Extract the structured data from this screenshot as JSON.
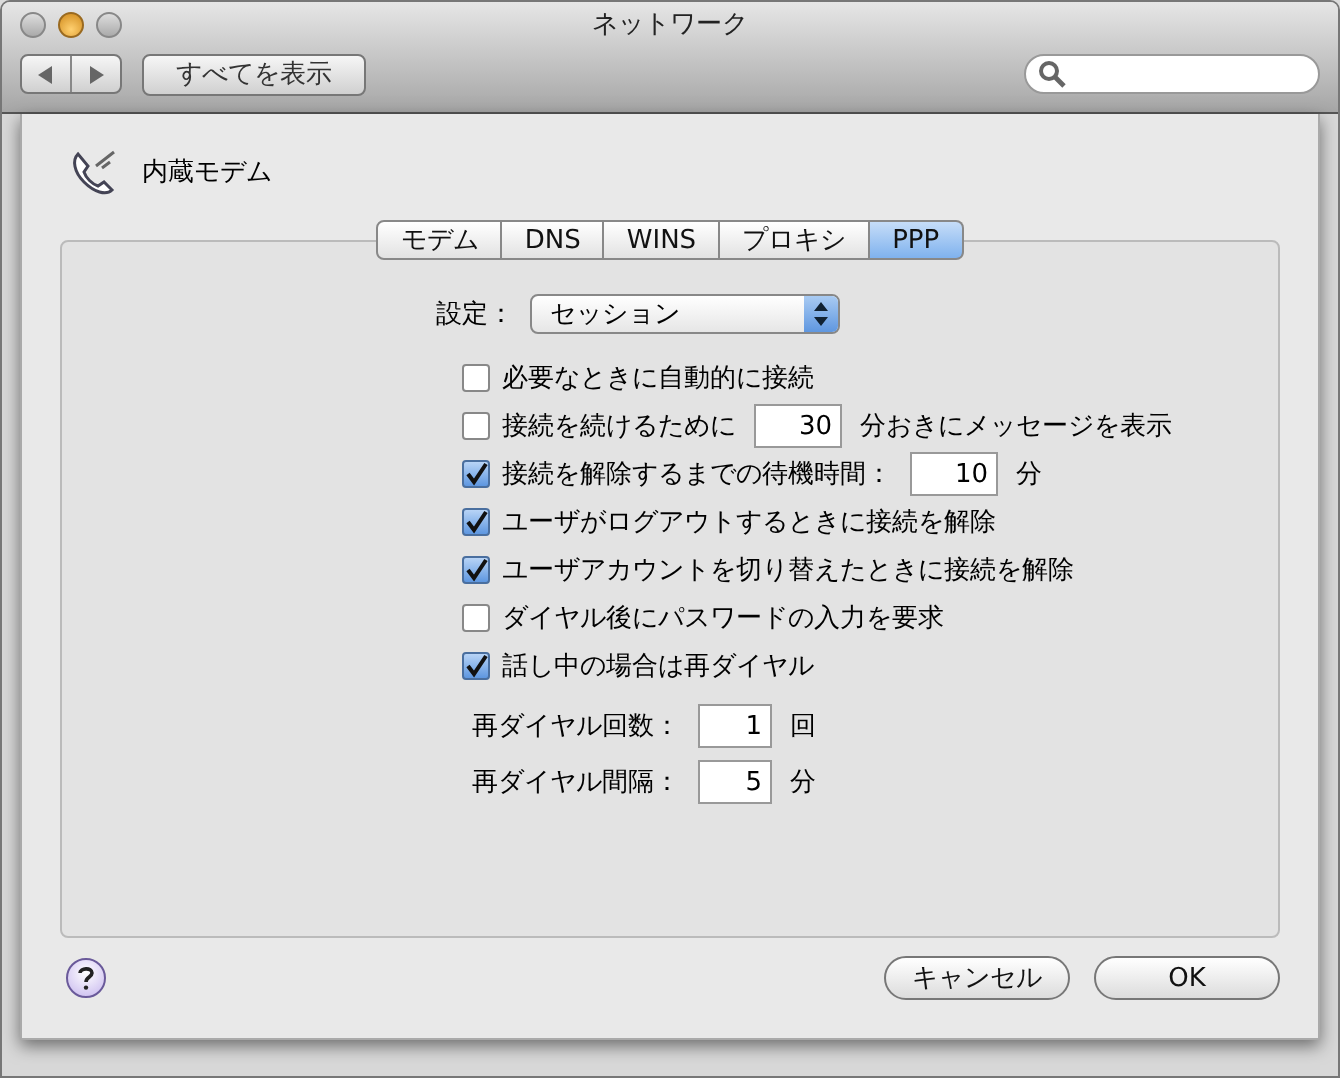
{
  "window": {
    "title": "ネットワーク"
  },
  "toolbar": {
    "show_all_button": "すべてを表示"
  },
  "sheet": {
    "device": "内蔵モデム",
    "tabs": [
      {
        "label": "モデム",
        "selected": false
      },
      {
        "label": "DNS",
        "selected": false
      },
      {
        "label": "WINS",
        "selected": false
      },
      {
        "label": "プロキシ",
        "selected": false
      },
      {
        "label": "PPP",
        "selected": true
      }
    ],
    "setting": {
      "label": "設定：",
      "value": "セッション"
    },
    "options": [
      {
        "kind": "check",
        "label": "必要なときに自動的に接続",
        "checked": false
      },
      {
        "kind": "check_field",
        "label": "接続を続けるために",
        "value": "30",
        "suffix": "分おきにメッセージを表示",
        "checked": false
      },
      {
        "kind": "check_field",
        "label": "接続を解除するまでの待機時間：",
        "value": "10",
        "suffix": "分",
        "checked": true
      },
      {
        "kind": "check",
        "label": "ユーザがログアウトするときに接続を解除",
        "checked": true
      },
      {
        "kind": "check",
        "label": "ユーザアカウントを切り替えたときに接続を解除",
        "checked": true
      },
      {
        "kind": "check",
        "label": "ダイヤル後にパスワードの入力を要求",
        "checked": false
      },
      {
        "kind": "check",
        "label": "話し中の場合は再ダイヤル",
        "checked": true
      }
    ],
    "redial_fields": [
      {
        "label": "再ダイヤル回数：",
        "value": "1",
        "unit": "回"
      },
      {
        "label": "再ダイヤル間隔：",
        "value": "5",
        "unit": "分"
      }
    ],
    "buttons": [
      "キャンセル",
      "OK"
    ]
  }
}
